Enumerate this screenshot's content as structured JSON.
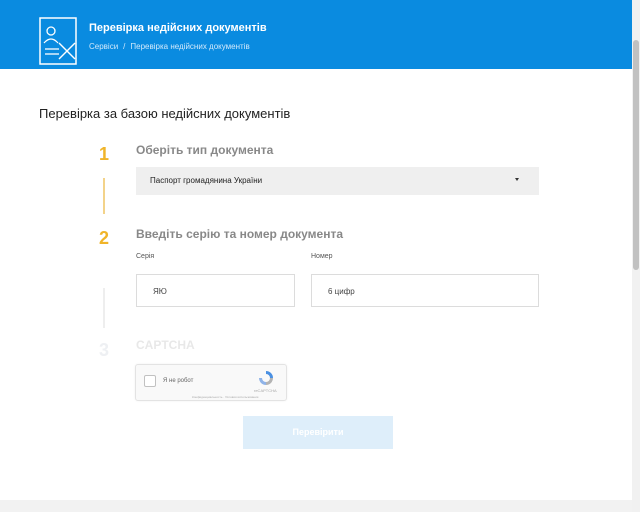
{
  "header": {
    "title": "Перевірка недійсних документів",
    "breadcrumb": [
      "Сервіси",
      "Перевірка недійсних документів"
    ],
    "icon": "document-check-icon",
    "background": "#0a8be0"
  },
  "main": {
    "heading": "Перевірка за базою недійсних документів",
    "steps": [
      {
        "number": "1",
        "title": "Оберіть тип документа"
      },
      {
        "number": "2",
        "title": "Введіть серію та номер документа"
      },
      {
        "number": "3",
        "title": "CAPTCHA"
      }
    ],
    "document_type": {
      "selected": "Паспорт громадянина України"
    },
    "series": {
      "label": "Серія",
      "placeholder": "ЯЮ"
    },
    "number": {
      "label": "Номер",
      "placeholder": "6 цифр"
    },
    "captcha": {
      "text": "Я не робот",
      "brand": "reCAPTCHA",
      "terms": "Конфиденциальность · Условия использования"
    },
    "submit_label": "Перевірити",
    "accent": "#f0b429"
  }
}
